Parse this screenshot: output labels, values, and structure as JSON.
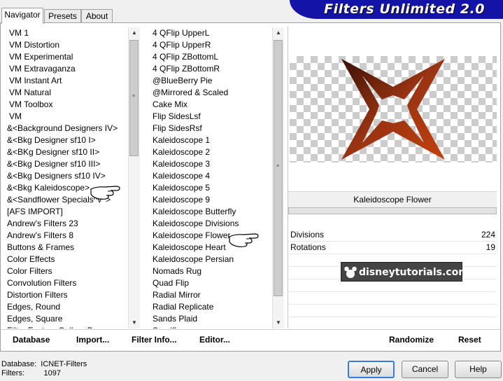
{
  "tabs": [
    "Navigator",
    "Presets",
    "About"
  ],
  "banner_title": "Filters Unlimited 2.0",
  "categories": [
    "VM 1",
    "VM Distortion",
    "VM Experimental",
    "VM Extravaganza",
    "VM Instant Art",
    "VM Natural",
    "VM Toolbox",
    "VM",
    "&<Background Designers IV>",
    "&<Bkg Designer sf10 I>",
    "&<BKg Designer sf10 II>",
    "&<Bkg Designer sf10 III>",
    "&<Bkg Designers sf10 IV>",
    "&<Bkg Kaleidoscope>",
    "&<Sandflower Specials^v^>",
    "[AFS IMPORT]",
    "Andrew's Filters 23",
    "Andrew's Filters 8",
    "Buttons & Frames",
    "Color Effects",
    "Color Filters",
    "Convolution Filters",
    "Distortion Filters",
    "Edges, Round",
    "Edges, Square",
    "Filter Factory Gallery B"
  ],
  "filters": [
    "4 QFlip UpperL",
    "4 QFlip UpperR",
    "4 QFlip ZBottomL",
    "4 QFlip ZBottomR",
    "@BlueBerry Pie",
    "@Mirrored & Scaled",
    "Cake Mix",
    "Flip SidesLsf",
    "Flip SidesRsf",
    "Kaleidoscope 1",
    "Kaleidoscope 2",
    "Kaleidoscope 3",
    "Kaleidoscope 4",
    "Kaleidoscope 5",
    "Kaleidoscope 9",
    "Kaleidoscope Butterfly",
    "Kaleidoscope Divisions",
    "Kaleidoscope Flower",
    "Kaleidoscope Heart",
    "Kaleidoscope Persian",
    "Nomads Rug",
    "Quad Flip",
    "Radial Mirror",
    "Radial Replicate",
    "Sands Plaid",
    "Sandflower"
  ],
  "toolbar": {
    "database": "Database",
    "import": "Import...",
    "filter_info": "Filter Info...",
    "editor": "Editor...",
    "randomize": "Randomize",
    "reset": "Reset"
  },
  "selected_filter": "Kaleidoscope Flower",
  "params": [
    {
      "label": "Divisions",
      "value": "224"
    },
    {
      "label": "Rotations",
      "value": "19"
    }
  ],
  "watermark": "disneytutorials.com",
  "status": {
    "db_label": "Database:",
    "db_value": "ICNET-Filters",
    "filters_label": "Filters:",
    "filters_value": "1097"
  },
  "buttons": {
    "apply": "Apply",
    "cancel": "Cancel",
    "help": "Help"
  },
  "colors": {
    "banner": "#1313a8",
    "star": "#8b2a10",
    "apply_border": "#3a7bd5"
  }
}
